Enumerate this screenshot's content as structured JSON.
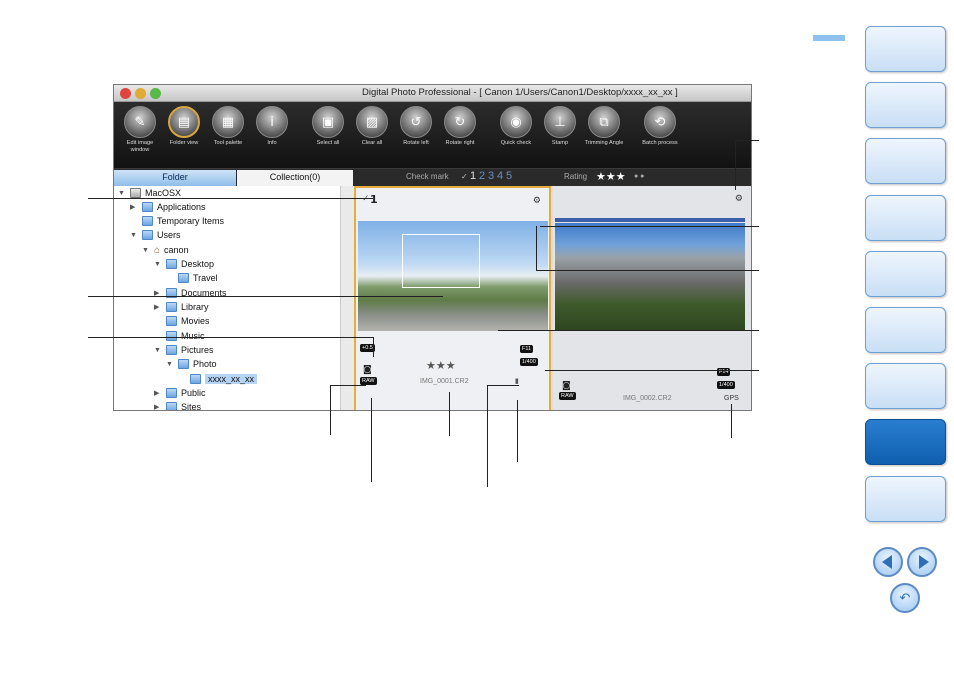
{
  "window": {
    "title": "Digital Photo Professional - [ Canon 1/Users/Canon1/Desktop/xxxx_xx_xx ]"
  },
  "toolbar": {
    "items": [
      {
        "label": "Edit image window",
        "icon": "edit-image-icon"
      },
      {
        "label": "Folder view",
        "icon": "folder-view-icon"
      },
      {
        "label": "Tool palette",
        "icon": "tool-palette-icon"
      },
      {
        "label": "Info",
        "icon": "info-icon"
      },
      {
        "label": "Select all",
        "icon": "select-all-icon"
      },
      {
        "label": "Clear all",
        "icon": "clear-all-icon"
      },
      {
        "label": "Rotate left",
        "icon": "rotate-left-icon"
      },
      {
        "label": "Rotate right",
        "icon": "rotate-right-icon"
      },
      {
        "label": "Quick check",
        "icon": "quick-check-icon"
      },
      {
        "label": "Stamp",
        "icon": "stamp-icon"
      },
      {
        "label": "Trimming Angle",
        "icon": "trimming-icon"
      },
      {
        "label": "Batch process",
        "icon": "batch-icon"
      }
    ]
  },
  "tabs": {
    "folder": "Folder",
    "collection": "Collection(0)"
  },
  "controls": {
    "check_mark_label": "Check mark",
    "check_marks": [
      "1",
      "2",
      "3",
      "4",
      "5"
    ],
    "rating_label": "Rating",
    "rating_stars": "★★★"
  },
  "tree": [
    {
      "label": "MacOSX",
      "level": 0,
      "expanded": true
    },
    {
      "label": "Applications",
      "level": 1,
      "expanded": false
    },
    {
      "label": "Temporary Items",
      "level": 1,
      "expanded": null
    },
    {
      "label": "Users",
      "level": 1,
      "expanded": true
    },
    {
      "label": "canon",
      "level": 2,
      "expanded": true
    },
    {
      "label": "Desktop",
      "level": 3,
      "expanded": true
    },
    {
      "label": "Travel",
      "level": 4,
      "expanded": null
    },
    {
      "label": "Documents",
      "level": 3,
      "expanded": false
    },
    {
      "label": "Library",
      "level": 3,
      "expanded": false
    },
    {
      "label": "Movies",
      "level": 3,
      "expanded": null
    },
    {
      "label": "Music",
      "level": 3,
      "expanded": null
    },
    {
      "label": "Pictures",
      "level": 3,
      "expanded": true
    },
    {
      "label": "Photo",
      "level": 4,
      "expanded": true
    },
    {
      "label": "xxxx_xx_xx",
      "level": 5,
      "expanded": null,
      "selected": true
    },
    {
      "label": "Public",
      "level": 3,
      "expanded": false
    },
    {
      "label": "Sites",
      "level": 3,
      "expanded": false
    }
  ],
  "thumbs": [
    {
      "check": "1",
      "filename": "IMG_0001.CR2",
      "stars": "★★★",
      "aperture": "F11",
      "shutter": "1/400",
      "ev": "+0.5",
      "format": "RAW"
    },
    {
      "filename": "IMG_0002.CR2",
      "aperture": "F14",
      "shutter": "1/400",
      "format": "RAW",
      "gps": "GPS"
    }
  ]
}
